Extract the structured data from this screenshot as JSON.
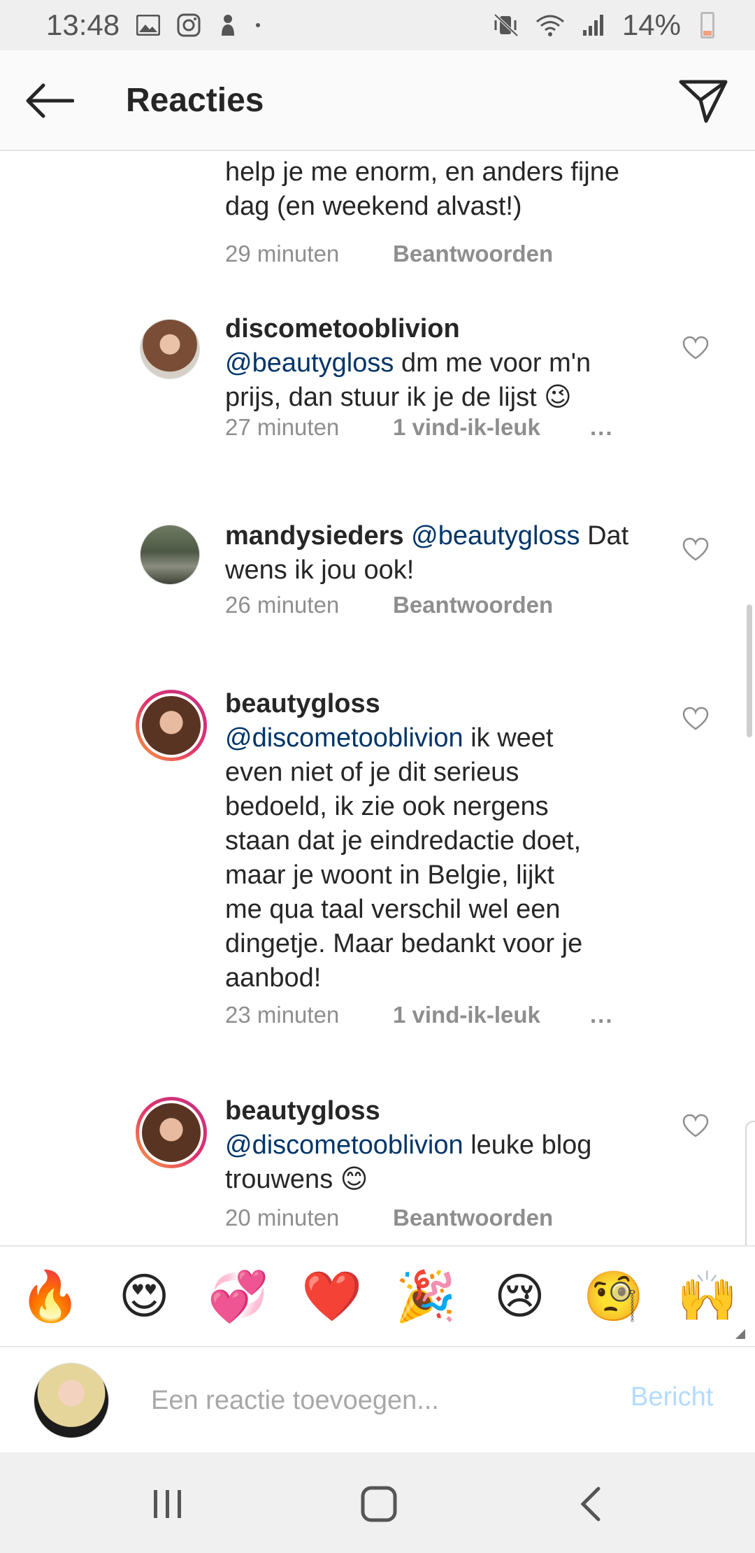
{
  "status_bar": {
    "time": "13:48",
    "battery": "14%",
    "left_icons": [
      "gallery-icon",
      "instagram-icon",
      "notification-icon"
    ],
    "right_icons": [
      "mute-icon",
      "wifi-icon",
      "signal-icon",
      "battery-icon"
    ]
  },
  "header": {
    "title": "Reacties",
    "back_icon": "arrow-left-icon",
    "send_icon": "paper-plane-icon"
  },
  "comments": [
    {
      "text_lines": [
        "help je me enorm, en anders fijne",
        "dag (en weekend alvast!)"
      ],
      "time": "29 minuten",
      "action": "Beantwoorden"
    },
    {
      "user": "discometooblivion",
      "mention": "@beautygloss",
      "text_a": " dm me voor m'n",
      "text_b": "prijs, dan stuur ik je de lijst 😉",
      "time": "27 minuten",
      "action": "1 vind-ik-leuk",
      "more": "..."
    },
    {
      "user": "mandysieders",
      "mention": "@beautygloss",
      "text_a": " Dat",
      "text_b": "wens ik jou ook!",
      "time": "26 minuten",
      "action": "Beantwoorden"
    },
    {
      "user": "beautygloss",
      "mention": "@discometooblivion",
      "text_a": " ik weet",
      "text_lines": [
        "even niet of je dit serieus",
        "bedoeld, ik zie ook nergens",
        "staan dat je eindredactie doet,",
        "maar je woont in Belgie, lijkt",
        "me qua taal verschil wel een",
        "dingetje. Maar bedankt voor je",
        "aanbod!"
      ],
      "time": "23 minuten",
      "action": "1 vind-ik-leuk",
      "more": "..."
    },
    {
      "user": "beautygloss",
      "mention": "@discometooblivion",
      "text_a": " leuke blog",
      "text_b": "trouwens 😊",
      "time": "20 minuten",
      "action": "Beantwoorden"
    }
  ],
  "emoji_bar": [
    "🔥",
    "😍",
    "💞",
    "❤️",
    "🎉",
    "😢",
    "🧐",
    "🙌"
  ],
  "composer": {
    "placeholder": "Een reactie toevoegen...",
    "post_label": "Bericht"
  },
  "colors": {
    "mention": "#003569",
    "secondary_text": "#8e8e8e",
    "post_disabled": "#b3dbff",
    "story_ring": "#e1306c"
  }
}
